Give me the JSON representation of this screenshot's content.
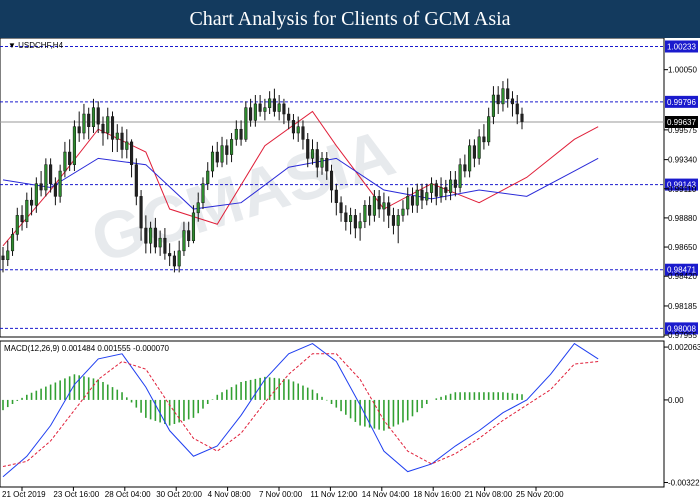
{
  "banner": {
    "title": "Chart Analysis for Clients of GCM Asia"
  },
  "watermark": "GCMASIA",
  "colors": {
    "banner_bg": "#133a5e",
    "bull": "#2e8b2e",
    "bear": "#222222",
    "ma_fast": "#e0203a",
    "ma_slow": "#2a2ad8",
    "level_line": "#1a1acd",
    "macd_line": "#1f3ff0",
    "signal_line": "#e0203a",
    "histogram": "#32a032",
    "current_price_bg": "#000000"
  },
  "chart_data": {
    "type": "candlestick",
    "title": "USDCHF,H4",
    "x_tick_labels": [
      "21 Oct 2019",
      "23 Oct 16:00",
      "28 Oct 04:00",
      "30 Oct 20:00",
      "4 Nov 08:00",
      "7 Nov 00:00",
      "11 Nov 12:00",
      "14 Nov 04:00",
      "18 Nov 16:00",
      "21 Nov 08:00",
      "25 Nov 20:00"
    ],
    "y_tick_labels": [
      "1.00050",
      "0.99575",
      "0.99340",
      "0.99110",
      "0.98880",
      "0.98650",
      "0.98420",
      "0.98185",
      "0.97955"
    ],
    "ylim": [
      0.9794,
      1.003
    ],
    "levels": [
      1.00233,
      0.99796,
      0.99143,
      0.98471,
      0.98008
    ],
    "level_labels": [
      "1.00233",
      "0.99796",
      "0.99143",
      "0.98471",
      "0.98008"
    ],
    "current_price": 0.99637,
    "current_price_label": "0.99637",
    "series": [
      {
        "name": "",
        "kind": "ma",
        "x": [
          0,
          10,
          20,
          30,
          35,
          45,
          55,
          65,
          70,
          80,
          90,
          100,
          110,
          120,
          125
        ],
        "y": [
          0.9866,
          0.991,
          0.9958,
          0.994,
          0.9895,
          0.9883,
          0.9945,
          0.9972,
          0.9945,
          0.9895,
          0.9915,
          0.99,
          0.992,
          0.995,
          0.996
        ]
      },
      {
        "name": "",
        "kind": "ma",
        "x": [
          0,
          10,
          20,
          30,
          40,
          50,
          60,
          70,
          80,
          90,
          100,
          110,
          120,
          125
        ],
        "y": [
          0.9918,
          0.9912,
          0.9935,
          0.993,
          0.9895,
          0.99,
          0.9928,
          0.9935,
          0.991,
          0.9903,
          0.991,
          0.9905,
          0.9925,
          0.9935
        ]
      }
    ],
    "candles": [
      [
        0.9858,
        0.9855,
        0.9865,
        0.9845
      ],
      [
        0.9855,
        0.9862,
        0.987,
        0.985
      ],
      [
        0.9862,
        0.9875,
        0.988,
        0.9858
      ],
      [
        0.9875,
        0.989,
        0.9896,
        0.987
      ],
      [
        0.989,
        0.9885,
        0.9898,
        0.9878
      ],
      [
        0.9885,
        0.9902,
        0.9908,
        0.988
      ],
      [
        0.9902,
        0.9898,
        0.9912,
        0.989
      ],
      [
        0.9898,
        0.9915,
        0.992,
        0.9892
      ],
      [
        0.9915,
        0.991,
        0.9925,
        0.9905
      ],
      [
        0.991,
        0.993,
        0.9935,
        0.9905
      ],
      [
        0.993,
        0.9915,
        0.9935,
        0.9908
      ],
      [
        0.9915,
        0.9905,
        0.992,
        0.9898
      ],
      [
        0.9905,
        0.9925,
        0.993,
        0.99
      ],
      [
        0.9925,
        0.994,
        0.9948,
        0.992
      ],
      [
        0.994,
        0.993,
        0.995,
        0.9925
      ],
      [
        0.993,
        0.996,
        0.9965,
        0.9925
      ],
      [
        0.996,
        0.9955,
        0.9972,
        0.9948
      ],
      [
        0.9955,
        0.997,
        0.9978,
        0.995
      ],
      [
        0.997,
        0.996,
        0.9975,
        0.995
      ],
      [
        0.996,
        0.9975,
        0.9982,
        0.9955
      ],
      [
        0.9975,
        0.9962,
        0.998,
        0.9955
      ],
      [
        0.9962,
        0.9955,
        0.9968,
        0.9945
      ],
      [
        0.9955,
        0.9968,
        0.9975,
        0.995
      ],
      [
        0.9968,
        0.995,
        0.9972,
        0.994
      ],
      [
        0.995,
        0.9955,
        0.9962,
        0.994
      ],
      [
        0.9955,
        0.9942,
        0.996,
        0.9935
      ],
      [
        0.9942,
        0.9948,
        0.9958,
        0.9935
      ],
      [
        0.9948,
        0.993,
        0.995,
        0.992
      ],
      [
        0.993,
        0.9905,
        0.9935,
        0.9898
      ],
      [
        0.9905,
        0.988,
        0.991,
        0.987
      ],
      [
        0.988,
        0.9868,
        0.989,
        0.986
      ],
      [
        0.9868,
        0.988,
        0.9885,
        0.986
      ],
      [
        0.988,
        0.9865,
        0.9888,
        0.986
      ],
      [
        0.9865,
        0.9872,
        0.9878,
        0.9858
      ],
      [
        0.9872,
        0.986,
        0.988,
        0.9855
      ],
      [
        0.986,
        0.9858,
        0.9868,
        0.985
      ],
      [
        0.9858,
        0.985,
        0.9862,
        0.9845
      ],
      [
        0.985,
        0.9862,
        0.987,
        0.9845
      ],
      [
        0.9862,
        0.9878,
        0.9885,
        0.9858
      ],
      [
        0.9878,
        0.987,
        0.9885,
        0.9865
      ],
      [
        0.987,
        0.9892,
        0.9898,
        0.9868
      ],
      [
        0.9892,
        0.99,
        0.9908,
        0.9885
      ],
      [
        0.99,
        0.9915,
        0.992,
        0.9895
      ],
      [
        0.9915,
        0.9925,
        0.9932,
        0.991
      ],
      [
        0.9925,
        0.994,
        0.9945,
        0.992
      ],
      [
        0.994,
        0.9932,
        0.9948,
        0.9928
      ],
      [
        0.9932,
        0.9945,
        0.9952,
        0.9928
      ],
      [
        0.9945,
        0.9938,
        0.995,
        0.993
      ],
      [
        0.9938,
        0.995,
        0.9955,
        0.9932
      ],
      [
        0.995,
        0.9958,
        0.9965,
        0.9945
      ],
      [
        0.9958,
        0.995,
        0.9965,
        0.9945
      ],
      [
        0.995,
        0.9975,
        0.998,
        0.9948
      ],
      [
        0.9975,
        0.9965,
        0.9982,
        0.996
      ],
      [
        0.9965,
        0.9978,
        0.9985,
        0.996
      ],
      [
        0.9978,
        0.9972,
        0.9985,
        0.9968
      ],
      [
        0.9972,
        0.9975,
        0.9982,
        0.9965
      ],
      [
        0.9975,
        0.9982,
        0.9988,
        0.997
      ],
      [
        0.9982,
        0.9972,
        0.999,
        0.9968
      ],
      [
        0.9972,
        0.9978,
        0.9985,
        0.9965
      ],
      [
        0.9978,
        0.997,
        0.9982,
        0.9962
      ],
      [
        0.997,
        0.9965,
        0.9975,
        0.9958
      ],
      [
        0.9965,
        0.9955,
        0.997,
        0.995
      ],
      [
        0.9955,
        0.996,
        0.9968,
        0.9948
      ],
      [
        0.996,
        0.995,
        0.9965,
        0.9942
      ],
      [
        0.995,
        0.9935,
        0.9955,
        0.9928
      ],
      [
        0.9935,
        0.9942,
        0.995,
        0.993
      ],
      [
        0.9942,
        0.9928,
        0.9948,
        0.992
      ],
      [
        0.9928,
        0.9935,
        0.994,
        0.9922
      ],
      [
        0.9935,
        0.9925,
        0.994,
        0.9918
      ],
      [
        0.9925,
        0.991,
        0.993,
        0.99
      ],
      [
        0.991,
        0.99,
        0.9915,
        0.989
      ],
      [
        0.99,
        0.9892,
        0.9905,
        0.9885
      ],
      [
        0.9892,
        0.9885,
        0.9898,
        0.9878
      ],
      [
        0.9885,
        0.989,
        0.9896,
        0.9875
      ],
      [
        0.989,
        0.988,
        0.9895,
        0.9872
      ],
      [
        0.988,
        0.9885,
        0.9892,
        0.987
      ],
      [
        0.9885,
        0.9898,
        0.9902,
        0.988
      ],
      [
        0.9898,
        0.989,
        0.9905,
        0.9882
      ],
      [
        0.989,
        0.9905,
        0.991,
        0.9885
      ],
      [
        0.9905,
        0.9895,
        0.991,
        0.9888
      ],
      [
        0.9895,
        0.99,
        0.9908,
        0.9885
      ],
      [
        0.99,
        0.989,
        0.9905,
        0.988
      ],
      [
        0.989,
        0.9882,
        0.9896,
        0.9875
      ],
      [
        0.9882,
        0.989,
        0.9895,
        0.9868
      ],
      [
        0.989,
        0.9895,
        0.9902,
        0.9885
      ],
      [
        0.9895,
        0.9905,
        0.9912,
        0.989
      ],
      [
        0.9905,
        0.9898,
        0.9912,
        0.9892
      ],
      [
        0.9898,
        0.991,
        0.9915,
        0.9892
      ],
      [
        0.991,
        0.9902,
        0.9915,
        0.9895
      ],
      [
        0.9902,
        0.9908,
        0.9915,
        0.9898
      ],
      [
        0.9908,
        0.9915,
        0.992,
        0.99
      ],
      [
        0.9915,
        0.9905,
        0.9918,
        0.9898
      ],
      [
        0.9905,
        0.9912,
        0.992,
        0.99
      ],
      [
        0.9912,
        0.9908,
        0.9918,
        0.9902
      ],
      [
        0.9908,
        0.9918,
        0.9925,
        0.9902
      ],
      [
        0.9918,
        0.9912,
        0.9925,
        0.9905
      ],
      [
        0.9912,
        0.993,
        0.9935,
        0.9908
      ],
      [
        0.993,
        0.9925,
        0.9938,
        0.992
      ],
      [
        0.9925,
        0.9945,
        0.995,
        0.992
      ],
      [
        0.9945,
        0.9935,
        0.995,
        0.9928
      ],
      [
        0.9935,
        0.9952,
        0.9958,
        0.993
      ],
      [
        0.9952,
        0.9948,
        0.9962,
        0.9942
      ],
      [
        0.9948,
        0.9968,
        0.9975,
        0.9945
      ],
      [
        0.9968,
        0.9985,
        0.9992,
        0.9962
      ],
      [
        0.9985,
        0.9978,
        0.9992,
        0.997
      ],
      [
        0.9978,
        0.999,
        0.9996,
        0.9972
      ],
      [
        0.999,
        0.9982,
        0.9998,
        0.9975
      ],
      [
        0.9982,
        0.9978,
        0.9988,
        0.9968
      ],
      [
        0.9978,
        0.997,
        0.9985,
        0.9962
      ],
      [
        0.997,
        0.9964,
        0.9975,
        0.9958
      ]
    ],
    "macd": {
      "label": "MACD(12,26,9) 0.001484 0.001555 -0.000070",
      "y_tick_labels": [
        "0.002063",
        "0.00",
        "-0.003225"
      ],
      "ylim": [
        -0.0034,
        0.0023
      ],
      "macd_x": [
        0,
        5,
        10,
        15,
        20,
        25,
        30,
        35,
        40,
        45,
        50,
        55,
        60,
        65,
        70,
        75,
        80,
        85,
        90,
        95,
        100,
        105,
        110,
        115,
        120,
        125
      ],
      "macd_y": [
        -0.003,
        -0.0022,
        -0.001,
        0.0006,
        0.0016,
        0.0018,
        0.0005,
        -0.0012,
        -0.0022,
        -0.0018,
        -0.0006,
        0.0008,
        0.0018,
        0.0022,
        0.0015,
        -0.0002,
        -0.002,
        -0.0028,
        -0.0025,
        -0.0018,
        -0.0012,
        -0.0005,
        0.0,
        0.001,
        0.0022,
        0.0016
      ],
      "signal_x": [
        0,
        5,
        10,
        15,
        20,
        25,
        30,
        35,
        40,
        45,
        50,
        55,
        60,
        65,
        70,
        75,
        80,
        85,
        90,
        95,
        100,
        105,
        110,
        115,
        120,
        125
      ],
      "signal_y": [
        -0.0026,
        -0.0024,
        -0.0016,
        -0.0004,
        0.0008,
        0.0015,
        0.0012,
        -0.0002,
        -0.0015,
        -0.002,
        -0.0013,
        -0.0001,
        0.001,
        0.0018,
        0.0018,
        0.0008,
        -0.0008,
        -0.002,
        -0.0025,
        -0.0021,
        -0.0015,
        -0.0008,
        -0.0002,
        0.0004,
        0.0014,
        0.0015
      ],
      "histogram_x": [
        0,
        5,
        10,
        15,
        20,
        25,
        30,
        35,
        40,
        45,
        50,
        55,
        60,
        65,
        70,
        75,
        80,
        85,
        90,
        95,
        100,
        105,
        110,
        115,
        120,
        125
      ],
      "histogram_y": [
        -0.0004,
        0.0002,
        0.0006,
        0.001,
        0.0008,
        0.0003,
        -0.0007,
        -0.001,
        -0.0007,
        0.0002,
        0.0007,
        0.0009,
        0.0008,
        0.0004,
        -0.0003,
        -0.001,
        -0.0012,
        -0.0008,
        0.0,
        0.0003,
        0.0003,
        0.0003,
        0.0002,
        0.0006,
        0.0008,
        0.0001
      ]
    }
  }
}
